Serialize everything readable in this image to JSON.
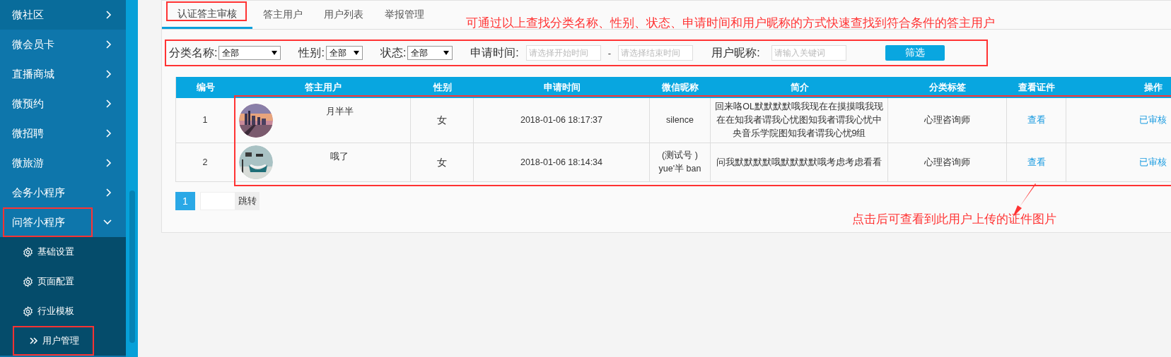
{
  "sidebar": {
    "items": [
      {
        "label": "微社区",
        "hovered": true,
        "expanded": false,
        "annotated": false
      },
      {
        "label": "微会员卡",
        "hovered": false,
        "expanded": false,
        "annotated": false
      },
      {
        "label": "直播商城",
        "hovered": false,
        "expanded": false,
        "annotated": false
      },
      {
        "label": "微预约",
        "hovered": false,
        "expanded": false,
        "annotated": false
      },
      {
        "label": "微招聘",
        "hovered": false,
        "expanded": false,
        "annotated": false
      },
      {
        "label": "微旅游",
        "hovered": false,
        "expanded": false,
        "annotated": false
      },
      {
        "label": "会务小程序",
        "hovered": false,
        "expanded": false,
        "annotated": false
      },
      {
        "label": "问答小程序",
        "hovered": false,
        "expanded": true,
        "annotated": true,
        "children": [
          {
            "label": "基础设置",
            "selected": false,
            "annotated": false
          },
          {
            "label": "页面配置",
            "selected": false,
            "annotated": false
          },
          {
            "label": "行业模板",
            "selected": false,
            "annotated": false
          },
          {
            "label": "用户管理",
            "selected": true,
            "annotated": true
          }
        ]
      }
    ]
  },
  "tabs": [
    {
      "label": "认证答主审核",
      "selected": true,
      "annotated": true
    },
    {
      "label": "答主用户",
      "selected": false,
      "annotated": false
    },
    {
      "label": "用户列表",
      "selected": false,
      "annotated": false
    },
    {
      "label": "举报管理",
      "selected": false,
      "annotated": false
    }
  ],
  "note_top": "可通过以上查找分类名称、性别、状态、申请时间和用户昵称的方式快速查找到符合条件的答主用户",
  "filters": {
    "annotated": true,
    "category": {
      "label": "分类名称:",
      "value": "全部"
    },
    "gender": {
      "label": "性别:",
      "value": "全部"
    },
    "status": {
      "label": "状态:",
      "value": "全部"
    },
    "apply_time": {
      "label": "申请时间:",
      "start_placeholder": "请选择开始时间",
      "separator": "-",
      "end_placeholder": "请选择结束时间"
    },
    "nickname": {
      "label": "用户昵称:",
      "placeholder": "请输入关键词"
    },
    "button": "筛选"
  },
  "table": {
    "rows_annotated": true,
    "columns": [
      "编号",
      "答主用户",
      "性别",
      "申请时间",
      "微信昵称",
      "简介",
      "分类标签",
      "查看证件",
      "操作"
    ],
    "rows": [
      {
        "no": "1",
        "name": "月半半",
        "gender": "女",
        "time": "2018-01-06 18:17:37",
        "nickname": "silence",
        "intro": "回来咯OL默默默默哦我现在在摸摸哦我现在在知我者谓我心忧图知我者谓我心忧中央音乐学院图知我者谓我心忧9组",
        "tag": "心理咨询师",
        "view": "查看",
        "action": "已审核"
      },
      {
        "no": "2",
        "name": "哦了",
        "gender": "女",
        "time": "2018-01-06 18:14:34",
        "nickname": "(测试号 ) yue'半 ban",
        "intro": "问我默默默默哦默默默默哦考虑考虑看看",
        "tag": "心理咨询师",
        "view": "查看",
        "action": "已审核"
      }
    ]
  },
  "pagination": {
    "pages": [
      {
        "label": "1",
        "selected": true
      }
    ],
    "jump": "跳转"
  },
  "note_bottom": "点击后可查看到此用户上传的证件图片"
}
